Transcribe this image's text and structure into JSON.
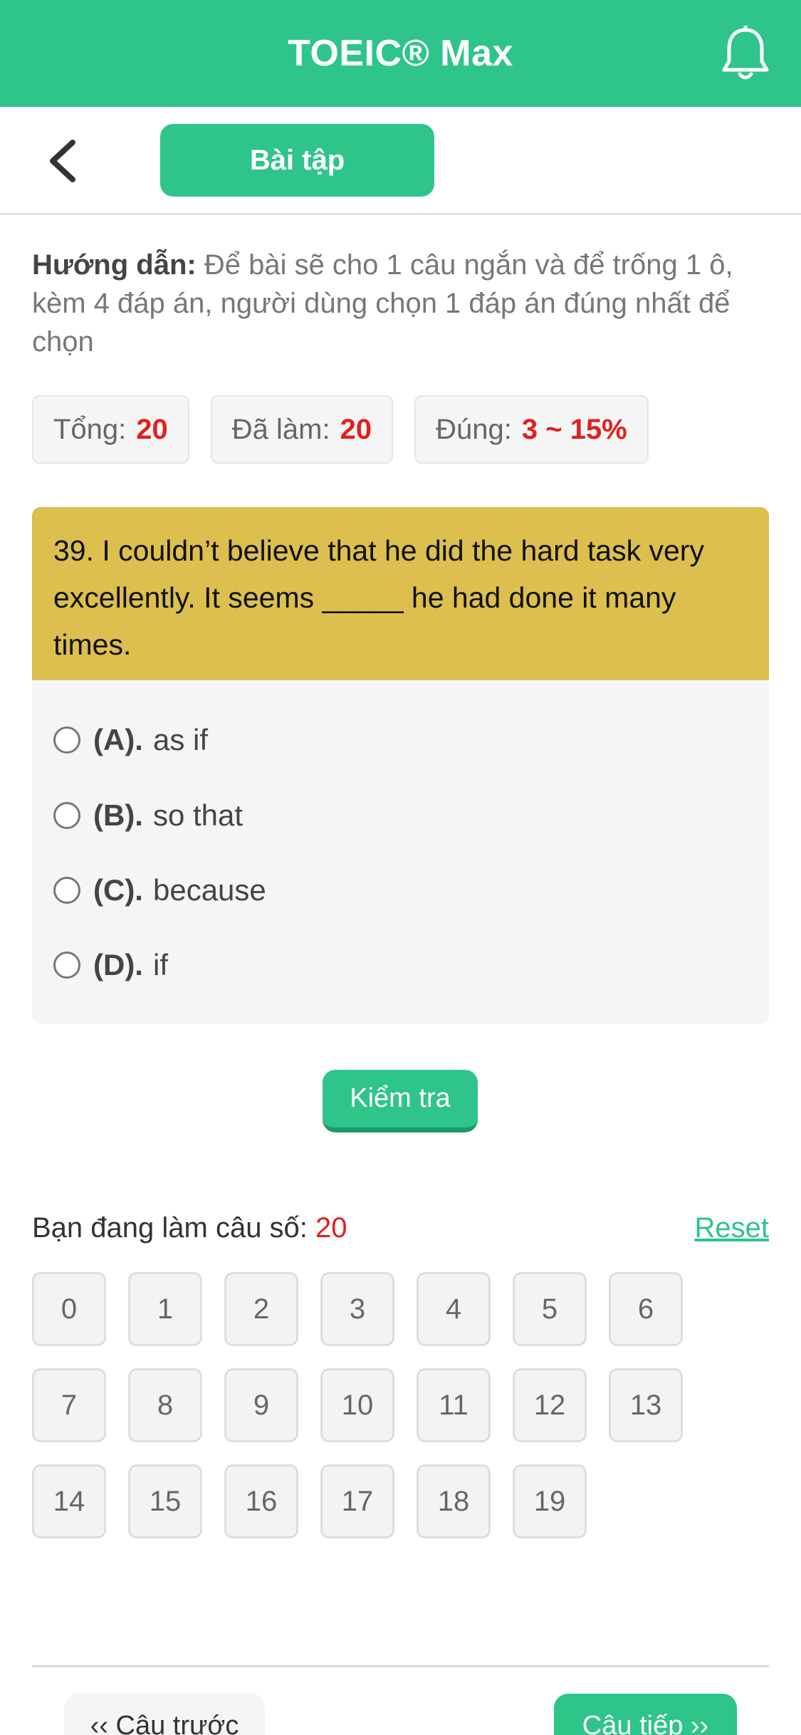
{
  "header": {
    "title": "TOEIC® Max"
  },
  "subheader": {
    "tab_label": "Bài tập"
  },
  "instructions": {
    "label": "Hướng dẫn:",
    "text": "Để bài sẽ cho 1 câu ngắn và để trống 1 ô, kèm 4 đáp án, người dùng chọn 1 đáp án đúng nhất để chọn"
  },
  "stats": {
    "total_label": "Tổng:",
    "total_value": "20",
    "done_label": "Đã làm:",
    "done_value": "20",
    "correct_label": "Đúng:",
    "correct_value": "3 ~ 15%"
  },
  "question": {
    "text": "39. I couldn’t believe that he did the hard task very excellently. It seems _____ he had done it many times."
  },
  "options": [
    {
      "letter": "(A).",
      "text": "as if"
    },
    {
      "letter": "(B).",
      "text": "so that"
    },
    {
      "letter": "(C).",
      "text": "because"
    },
    {
      "letter": "(D).",
      "text": "if"
    }
  ],
  "check_button": "Kiểm tra",
  "progress": {
    "label": "Bạn đang làm câu số:",
    "current": "20",
    "reset": "Reset"
  },
  "grid_numbers": [
    "0",
    "1",
    "2",
    "3",
    "4",
    "5",
    "6",
    "7",
    "8",
    "9",
    "10",
    "11",
    "12",
    "13",
    "14",
    "15",
    "16",
    "17",
    "18",
    "19"
  ],
  "footer": {
    "prev": "‹‹ Câu trước",
    "next": "Câu tiếp ››"
  },
  "colors": {
    "brand": "#2ec48a",
    "question_bg": "#dcbf4e",
    "highlight": "#e02020"
  }
}
